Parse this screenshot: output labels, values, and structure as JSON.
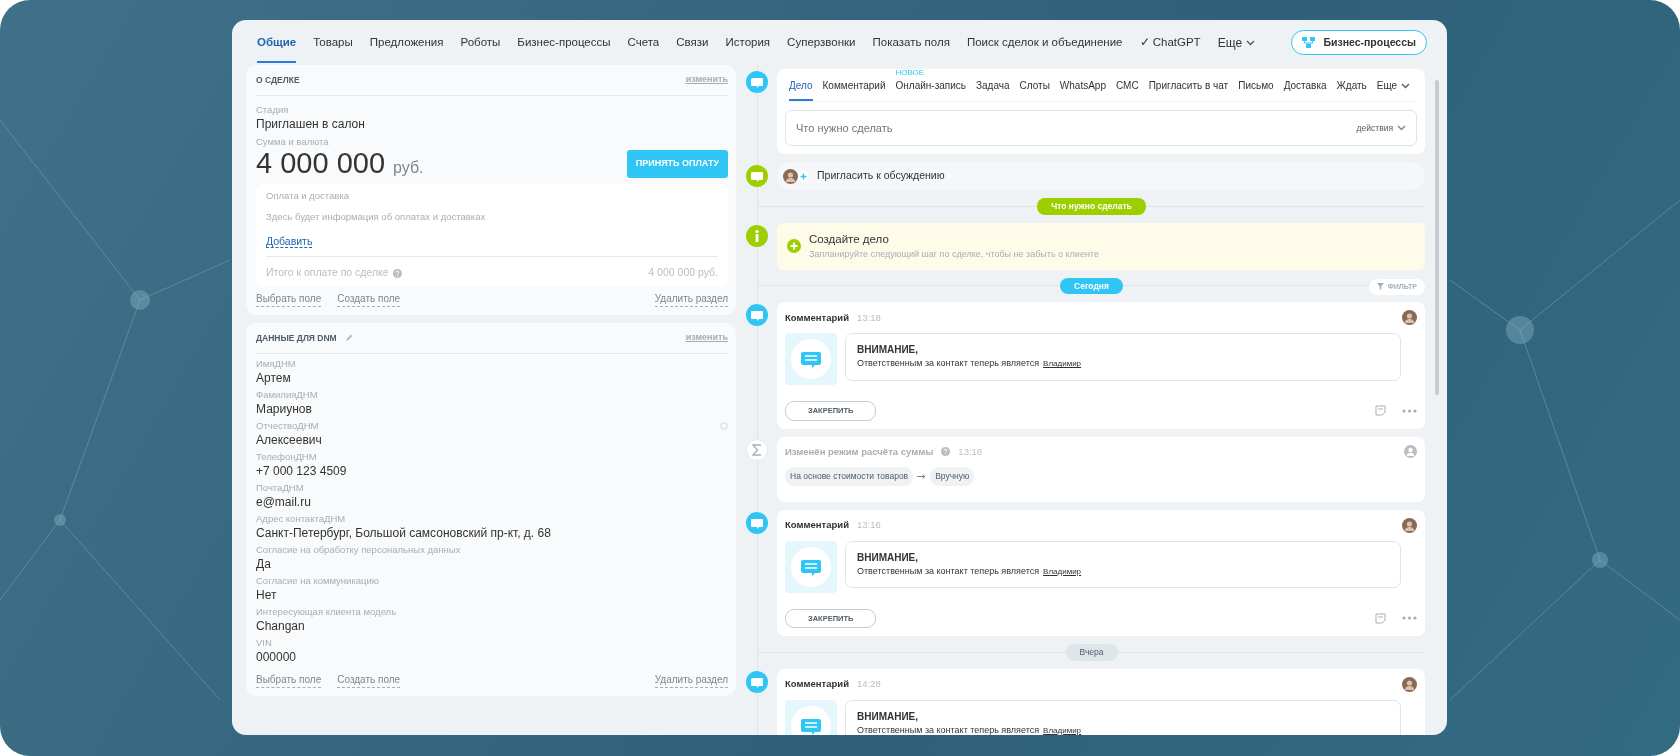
{
  "nav": {
    "tabs": [
      {
        "label": "Общие",
        "selected": true
      },
      {
        "label": "Товары",
        "selected": false
      },
      {
        "label": "Предложения",
        "selected": false
      },
      {
        "label": "Роботы",
        "selected": false
      },
      {
        "label": "Бизнес-процессы",
        "selected": false
      },
      {
        "label": "Счета",
        "selected": false
      },
      {
        "label": "Связи",
        "selected": false
      },
      {
        "label": "История",
        "selected": false
      },
      {
        "label": "Суперзвонки",
        "selected": false
      },
      {
        "label": "Показать поля",
        "selected": false
      },
      {
        "label": "Поиск сделок и объединение",
        "selected": false
      },
      {
        "label": "✓ ChatGPT",
        "selected": false
      }
    ],
    "more": "Еще",
    "process_button": "Бизнес-процессы"
  },
  "about": {
    "title": "О СДЕЛКЕ",
    "edit": "изменить",
    "stage_label": "Стадия",
    "stage": "Приглашен в салон",
    "amount_label": "Сумма и валюта",
    "amount": "4 000 000",
    "currency": "руб.",
    "pay_button": "ПРИНЯТЬ ОПЛАТУ",
    "payment": {
      "title": "Оплата и доставка",
      "text": "Здесь будет информация об оплатах и доставках",
      "add_link": "Добавить",
      "total_label": "Итого к оплате по сделке",
      "total": "4 000 000 руб."
    },
    "footer": {
      "select_field": "Выбрать поле",
      "create_field": "Создать поле",
      "delete_section": "Удалить раздел"
    }
  },
  "dnm": {
    "title": "ДАННЫЕ ДЛЯ DNM",
    "edit": "изменить",
    "fields": [
      {
        "label": "ИмяДНМ",
        "value": "Артем"
      },
      {
        "label": "ФамилияДНМ",
        "value": "Мариунов"
      },
      {
        "label": "ОтчествоДНМ",
        "value": "Алексеевич"
      },
      {
        "label": "ТелефонДНМ",
        "value": "+7 000 123 4509"
      },
      {
        "label": "ПочтаДНМ",
        "value": "e@mail.ru"
      },
      {
        "label": "Адрес контактаДНМ",
        "value": "Санкт-Петербург, Большой самсоновский пр-кт, д. 68"
      },
      {
        "label": "Согласие на обработку персональных данных",
        "value": "Да"
      },
      {
        "label": "Согласие на коммуникацию",
        "value": "Нет"
      },
      {
        "label": "Интересующая клиента модель",
        "value": "Changan"
      },
      {
        "label": "VIN",
        "value": "000000"
      }
    ],
    "footer": {
      "select_field": "Выбрать поле",
      "create_field": "Создать поле",
      "delete_section": "Удалить раздел"
    }
  },
  "composer": {
    "tabs": [
      {
        "label": "Дело",
        "selected": true
      },
      {
        "label": "Комментарий",
        "selected": false
      },
      {
        "label": "Онлайн-запись",
        "selected": false,
        "badge": "НОВОЕ"
      },
      {
        "label": "Задача",
        "selected": false
      },
      {
        "label": "Слоты",
        "selected": false
      },
      {
        "label": "WhatsApp",
        "selected": false
      },
      {
        "label": "СМС",
        "selected": false
      },
      {
        "label": "Пригласить в чат",
        "selected": false
      },
      {
        "label": "Письмо",
        "selected": false
      },
      {
        "label": "Доставка",
        "selected": false
      },
      {
        "label": "Ждать",
        "selected": false
      }
    ],
    "more": "Еще",
    "placeholder": "Что нужно сделать",
    "actions": "действия"
  },
  "invite": {
    "label": "Пригласить к обсуждению"
  },
  "timeline": [
    {
      "kind": "divider",
      "label": "Что нужно сделать",
      "color": "#9dcf00"
    },
    {
      "kind": "todo",
      "title": "Создайте дело",
      "text": "Запланируйте следующий шаг по сделке, чтобы не забыть о клиенте"
    },
    {
      "kind": "divider",
      "label": "Сегодня",
      "color": "#2fc6f6",
      "filter_button": "ФИЛЬТР"
    },
    {
      "kind": "comment",
      "title": "Комментарий",
      "time": "13:18",
      "heading": "ВНИМАНИЕ,",
      "text": "Ответственным за контакт теперь является",
      "mention": "Владимир",
      "pin_button": "ЗАКРЕПИТЬ"
    },
    {
      "kind": "sum_change",
      "title": "Изменён режим расчёта суммы",
      "time": "13:18",
      "from": "На основе стоимости товаров",
      "to": "Вручную"
    },
    {
      "kind": "comment",
      "title": "Комментарий",
      "time": "13:16",
      "heading": "ВНИМАНИЕ,",
      "text": "Ответственным за контакт теперь является",
      "mention": "Владимир",
      "pin_button": "ЗАКРЕПИТЬ"
    },
    {
      "kind": "divider",
      "label": "Вчера",
      "color": "#dfe6ea"
    },
    {
      "kind": "comment",
      "title": "Комментарий",
      "time": "14:28",
      "heading": "ВНИМАНИЕ,",
      "text": "Ответственным за контакт теперь является",
      "mention": "Владимир"
    }
  ]
}
